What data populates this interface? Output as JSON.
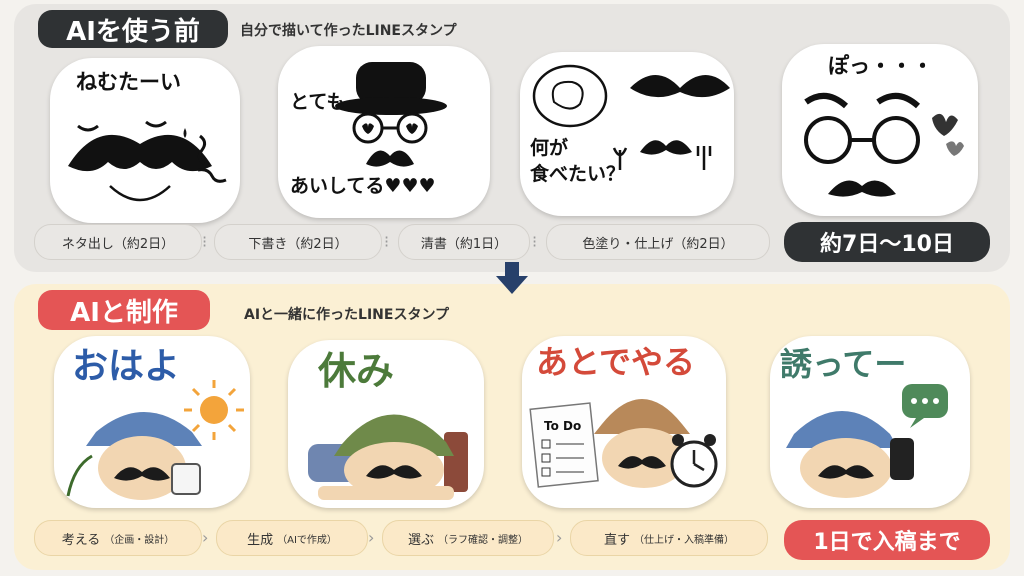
{
  "top": {
    "tag": "AIを使う前",
    "subtitle": "自分で描いて作ったLINEスタンプ",
    "stickers": [
      {
        "text": "ねむたーい"
      },
      {
        "text_line1": "とても",
        "text_line2": "あいしてる♥♥♥"
      },
      {
        "text_line1": "何が",
        "text_line2": "食べたい？"
      },
      {
        "text": "ぽっ・・・"
      }
    ],
    "steps": [
      {
        "label": "ネタ出し（約2日）"
      },
      {
        "label": "下書き（約2日）"
      },
      {
        "label": "清書（約1日）"
      },
      {
        "label": "色塗り・仕上げ（約2日）"
      }
    ],
    "result": "約7日〜10日"
  },
  "bottom": {
    "tag": "AIと制作",
    "subtitle": "AIと一緒に作ったLINEスタンプ",
    "stickers": [
      {
        "text": "おはよ"
      },
      {
        "text": "休み"
      },
      {
        "text": "あとでやる",
        "memo": "To Do"
      },
      {
        "text": "誘ってー"
      }
    ],
    "steps": [
      {
        "label": "考える",
        "detail": "（企画・設計）"
      },
      {
        "label": "生成",
        "detail": "（AIで作成）"
      },
      {
        "label": "選ぶ",
        "detail": "（ラフ確認・調整）"
      },
      {
        "label": "直す",
        "detail": "（仕上げ・入稿準備）"
      }
    ],
    "result": "1日で入稿まで"
  },
  "colors": {
    "dark": "#2f3234",
    "accent_red": "#e45555",
    "panel_top": "#e7e5e2",
    "panel_bottom": "#fbf0d4"
  }
}
